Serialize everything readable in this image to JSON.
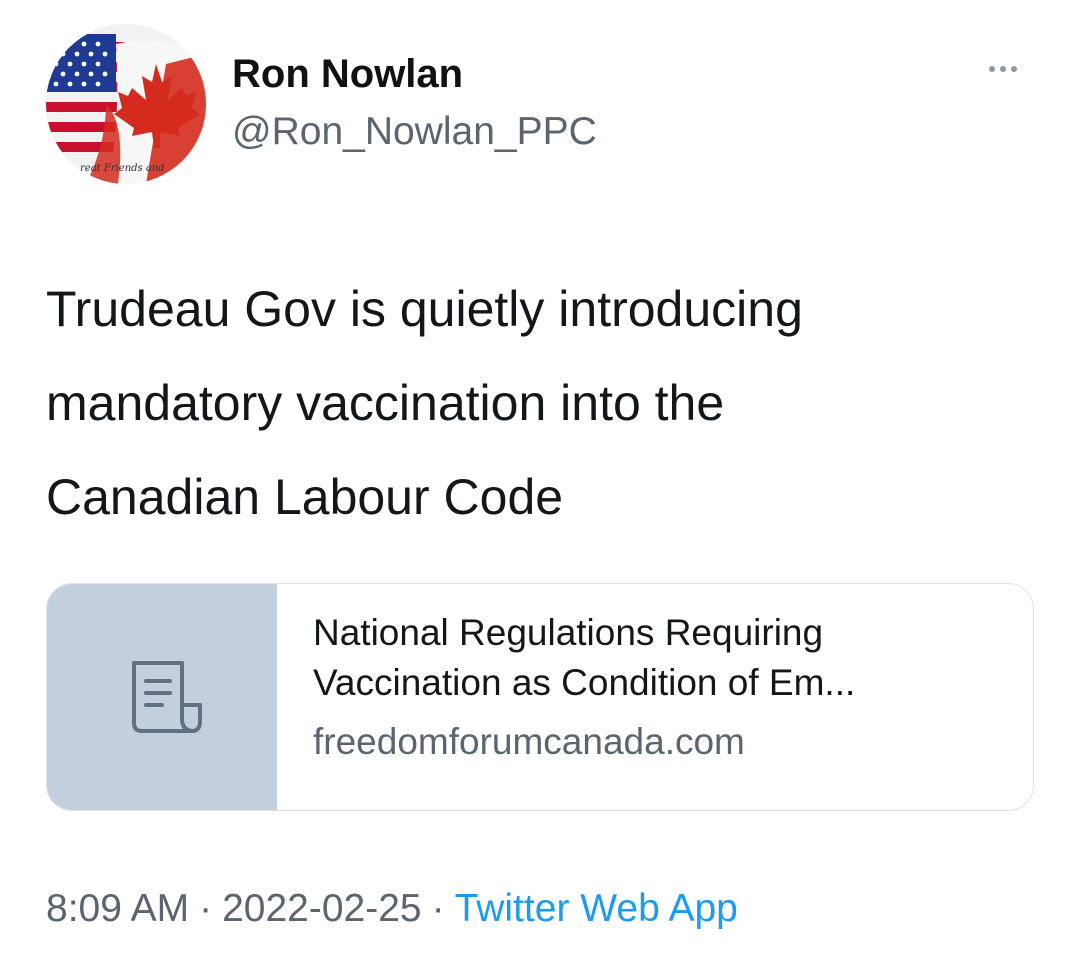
{
  "author": {
    "display_name": "Ron Nowlan",
    "handle": "@Ron_Nowlan_PPC",
    "avatar_caption": "reat Friends and"
  },
  "tweet": {
    "text_lines": [
      "Trudeau Gov is quietly introducing",
      "mandatory vaccination into the",
      "Canadian Labour Code"
    ]
  },
  "link_card": {
    "title_line1": "National Regulations Requiring",
    "title_line2": "Vaccination as Condition of Em...",
    "domain": "freedomforumcanada.com",
    "icon": "document-icon"
  },
  "meta": {
    "time": "8:09 AM",
    "separator": "·",
    "date": "2022-02-25",
    "source": "Twitter Web App"
  },
  "colors": {
    "accent_link": "#1d9bf0",
    "secondary_text": "#5b6570",
    "card_thumb_bg": "#c3cfdc"
  }
}
